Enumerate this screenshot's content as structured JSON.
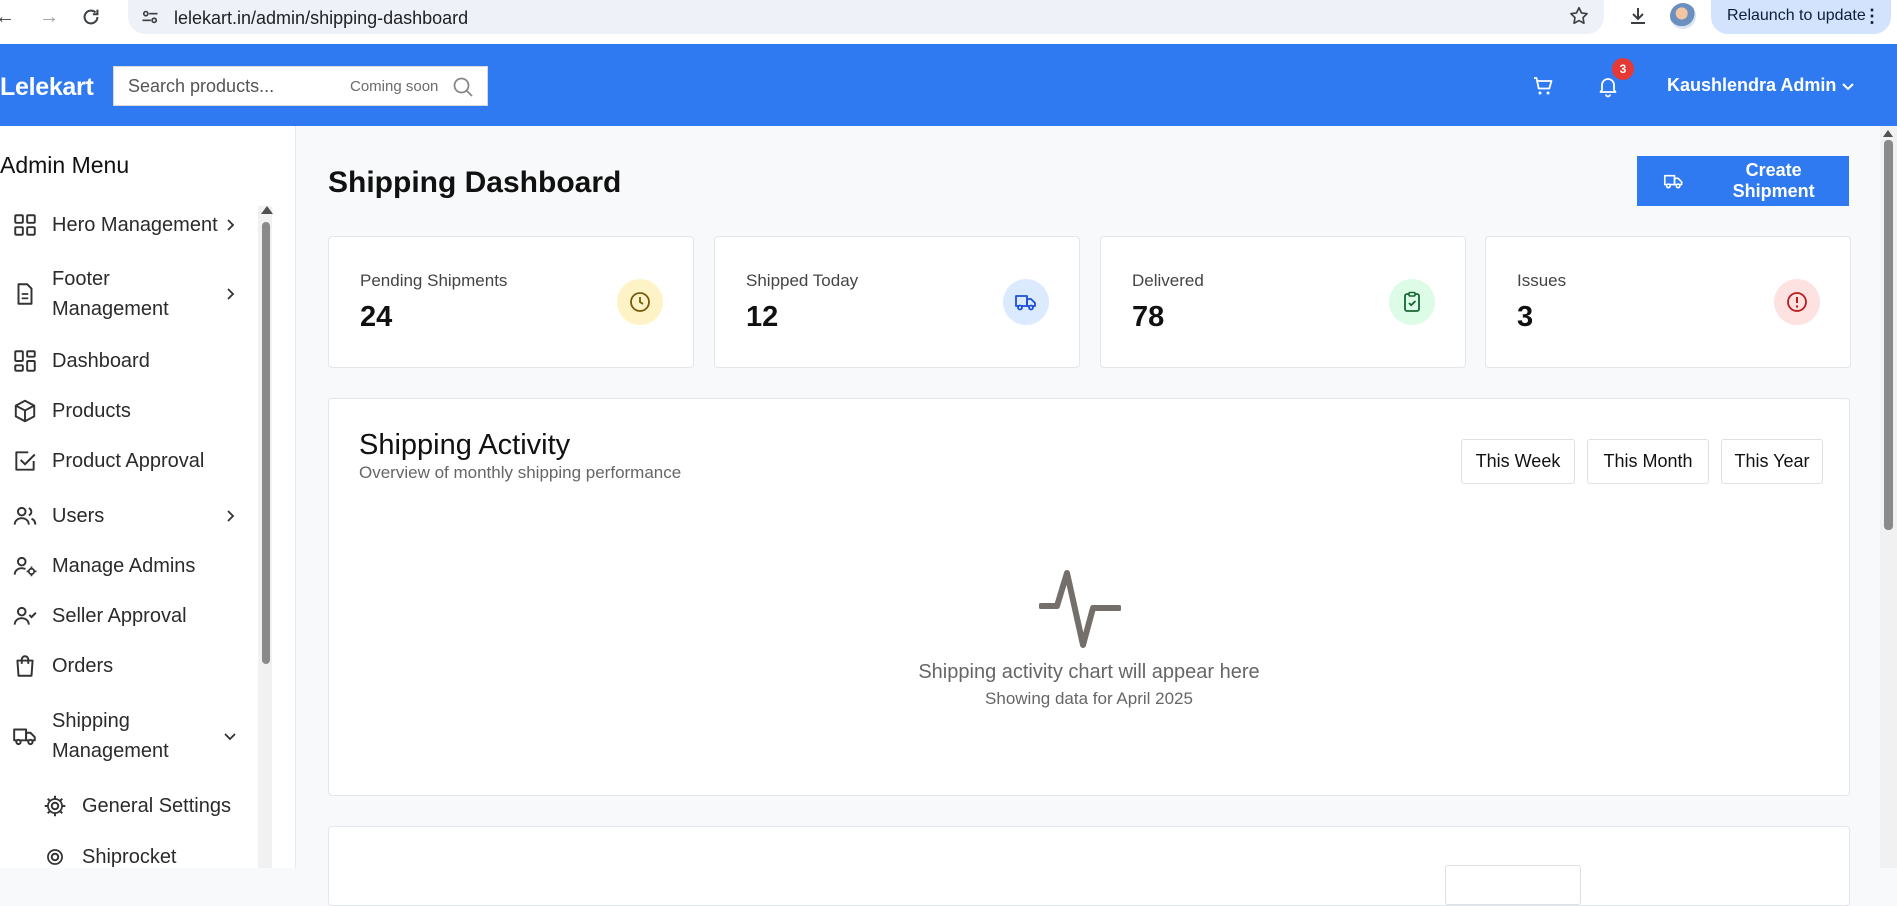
{
  "browser": {
    "url": "lelekart.in/admin/shipping-dashboard",
    "relaunch_label": "Relaunch to update"
  },
  "header": {
    "logo": "Lelekart",
    "search_placeholder": "Search products...",
    "search_badge": "Coming soon",
    "notification_count": "3",
    "user_name": "Kaushlendra Admin"
  },
  "sidebar": {
    "title": "Admin Menu",
    "items": [
      {
        "label": "Hero Management",
        "icon": "grid-icon",
        "chevron": "right"
      },
      {
        "label": "Footer Management",
        "icon": "document-icon",
        "chevron": "right"
      },
      {
        "label": "Dashboard",
        "icon": "dashboard-icon"
      },
      {
        "label": "Products",
        "icon": "box-icon"
      },
      {
        "label": "Product Approval",
        "icon": "check-square-icon"
      },
      {
        "label": "Users",
        "icon": "users-icon",
        "chevron": "right"
      },
      {
        "label": "Manage Admins",
        "icon": "user-cog-icon"
      },
      {
        "label": "Seller Approval",
        "icon": "user-check-icon"
      },
      {
        "label": "Orders",
        "icon": "shopping-bag-icon"
      },
      {
        "label": "Shipping Management",
        "icon": "truck-icon",
        "chevron": "down"
      },
      {
        "label": "General Settings",
        "icon": "gear-icon"
      },
      {
        "label": "Shiprocket",
        "icon": "gear-icon"
      }
    ]
  },
  "main": {
    "title": "Shipping Dashboard",
    "create_button": "Create Shipment",
    "stats": [
      {
        "label": "Pending Shipments",
        "value": "24",
        "icon": "clock-icon",
        "color": "#fef3c7"
      },
      {
        "label": "Shipped Today",
        "value": "12",
        "icon": "truck-icon",
        "color": "#dbeafe"
      },
      {
        "label": "Delivered",
        "value": "78",
        "icon": "clipboard-check-icon",
        "color": "#dcfce7"
      },
      {
        "label": "Issues",
        "value": "3",
        "icon": "alert-circle-icon",
        "color": "#fee2e2"
      }
    ],
    "activity": {
      "title": "Shipping Activity",
      "subtitle": "Overview of monthly shipping performance",
      "ranges": [
        "This Week",
        "This Month",
        "This Year"
      ],
      "empty_title": "Shipping activity chart will appear here",
      "empty_subtitle": "Showing data for April 2025"
    }
  },
  "colors": {
    "accent": "#2f7af0",
    "badge": "#e53935"
  }
}
